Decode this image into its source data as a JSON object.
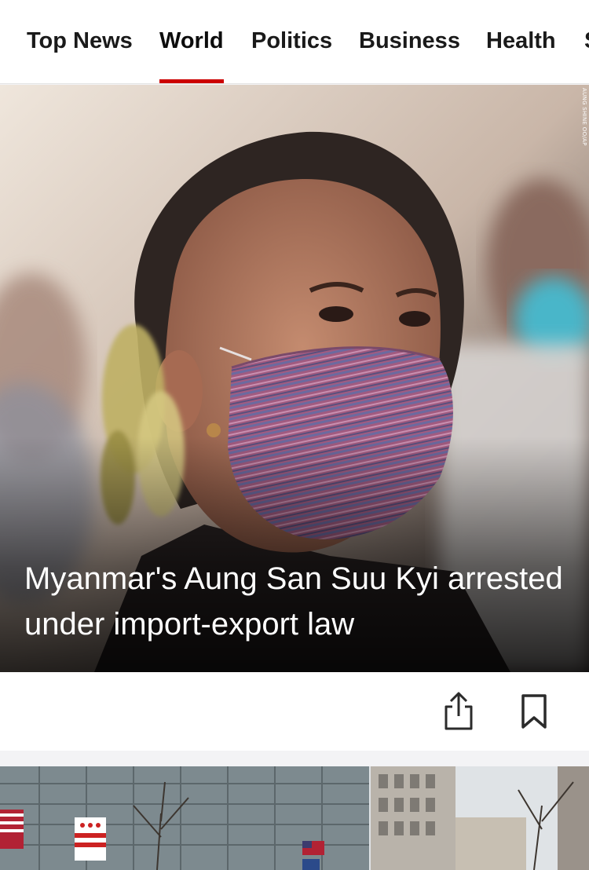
{
  "nav": {
    "tabs": [
      {
        "label": "Top News",
        "active": false
      },
      {
        "label": "World",
        "active": true
      },
      {
        "label": "Politics",
        "active": false
      },
      {
        "label": "Business",
        "active": false
      },
      {
        "label": "Health",
        "active": false
      },
      {
        "label": "S",
        "active": false
      }
    ],
    "accent_color": "#cc0000"
  },
  "hero": {
    "headline": "Myanmar's Aung San Suu Kyi arrested under import-export law",
    "photo_credit": "AUNG SHINE OO/AP"
  },
  "actions": {
    "share_icon": "share-icon",
    "bookmark_icon": "bookmark-icon"
  }
}
